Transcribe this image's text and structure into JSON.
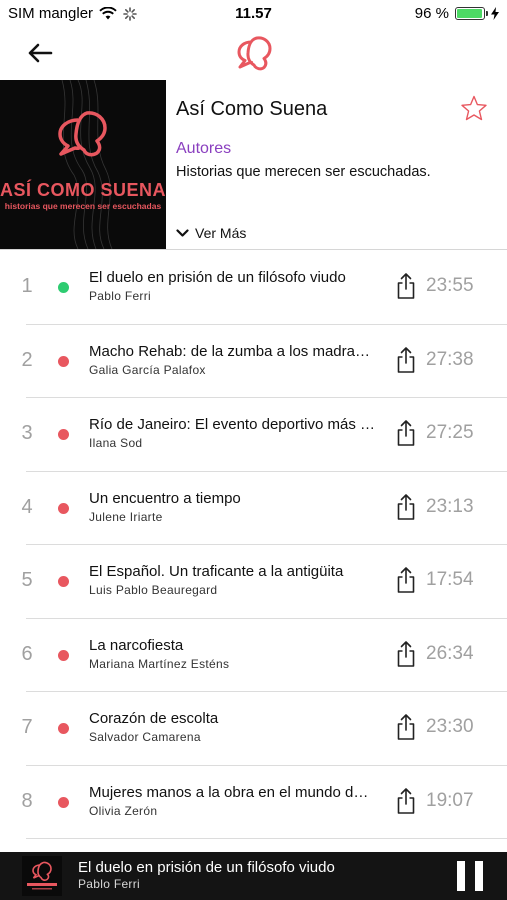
{
  "status_bar": {
    "carrier": "SIM mangler",
    "time": "11.57",
    "battery": "96 %",
    "battery_level": 0.96
  },
  "nav": {
    "back_icon": "back-arrow-icon",
    "logo_icon": "speech-bubbles-logo-icon"
  },
  "podcast": {
    "cover_title": "ASÍ COMO SUENA",
    "cover_subtitle": "historias que merecen ser escuchadas",
    "title": "Así Como Suena",
    "authors_label": "Autores",
    "description": "Historias que merecen ser escuchadas.",
    "more_label": "Ver Más",
    "favorite_icon": "star-icon"
  },
  "colors": {
    "brand": "#e8575f",
    "accent_purple": "#8a3fbf",
    "played": "#2ecc71",
    "unplayed": "#e8575f",
    "muted": "#a0a0a0"
  },
  "episodes": [
    {
      "number": "1",
      "title": "El duelo en prisión de un filósofo viudo",
      "author": "Pablo  Ferri",
      "duration": "23:55",
      "status": "played"
    },
    {
      "number": "2",
      "title": "Macho Rehab: de la zumba a los madrazos",
      "author": "Galia García Palafox",
      "duration": "27:38",
      "status": "unplayed"
    },
    {
      "number": "3",
      "title": "Río de Janeiro: El evento deportivo más caro",
      "author": "Ilana  Sod",
      "duration": "27:25",
      "status": "unplayed"
    },
    {
      "number": "4",
      "title": "Un encuentro a tiempo",
      "author": "Julene Iriarte",
      "duration": "23:13",
      "status": "unplayed"
    },
    {
      "number": "5",
      "title": "El Español. Un traficante a la antigüita",
      "author": "Luis Pablo Beauregard",
      "duration": "17:54",
      "status": "unplayed"
    },
    {
      "number": "6",
      "title": "La narcofiesta",
      "author": "Mariana Martínez Esténs",
      "duration": "26:34",
      "status": "unplayed"
    },
    {
      "number": "7",
      "title": "Corazón de escolta",
      "author": "Salvador  Camarena",
      "duration": "23:30",
      "status": "unplayed"
    },
    {
      "number": "8",
      "title": "Mujeres manos a la obra en el mundo de la construcción",
      "author": "Olivia Zerón",
      "duration": "19:07",
      "status": "unplayed"
    }
  ],
  "player": {
    "title": "El duelo en prisión de un filósofo viudo",
    "author": "Pablo  Ferri",
    "pause_icon": "pause-icon"
  }
}
